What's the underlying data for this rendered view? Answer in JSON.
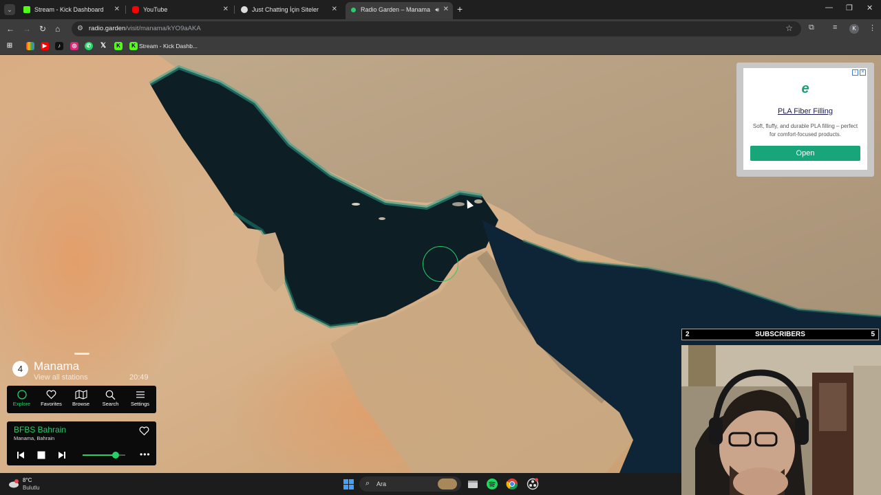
{
  "browser": {
    "tabs": [
      {
        "label": "Stream - Kick Dashboard",
        "icon": "kick-icon",
        "active": false
      },
      {
        "label": "YouTube",
        "icon": "youtube-icon",
        "active": false
      },
      {
        "label": "Just Chatting İçin Siteler",
        "icon": "page-icon",
        "active": false
      },
      {
        "label": "Radio Garden – Manama",
        "icon": "radio-garden-icon",
        "active": true
      }
    ],
    "url_host": "radio.garden",
    "url_path": "/visit/manama/kYO9aAKA",
    "profile_initial": "K",
    "bookmarks": {
      "items": [
        "gmail-icon",
        "youtube-icon",
        "tiktok-icon",
        "instagram-icon",
        "whatsapp-icon",
        "x-icon",
        "kick-icon"
      ],
      "folder_label": "Stream - Kick Dashb..."
    }
  },
  "ad": {
    "title": "PLA Fiber Filling",
    "description": "Soft, fluffy, and durable PLA filling – perfect for comfort-focused products.",
    "button": "Open",
    "accent": "#18a57a"
  },
  "radio": {
    "location_count": "4",
    "location_name": "Manama",
    "view_all": "View all stations",
    "local_time": "20:49",
    "nav": [
      {
        "label": "Explore",
        "icon": "explore-icon",
        "active": true
      },
      {
        "label": "Favorites",
        "icon": "heart-icon",
        "active": false
      },
      {
        "label": "Browse",
        "icon": "map-icon",
        "active": false
      },
      {
        "label": "Search",
        "icon": "search-icon",
        "active": false
      },
      {
        "label": "Settings",
        "icon": "menu-icon",
        "active": false
      }
    ],
    "player": {
      "station": "BFBS Bahrain",
      "place": "Manama, Bahrain",
      "volume": 0.77
    },
    "accent": "#25d06b"
  },
  "stream": {
    "subs_current": "2",
    "subs_label": "SUBSCRIBERS",
    "subs_goal": "5"
  },
  "taskbar": {
    "temperature": "8°C",
    "weather": "Bulutlu",
    "search_placeholder": "Ara"
  }
}
